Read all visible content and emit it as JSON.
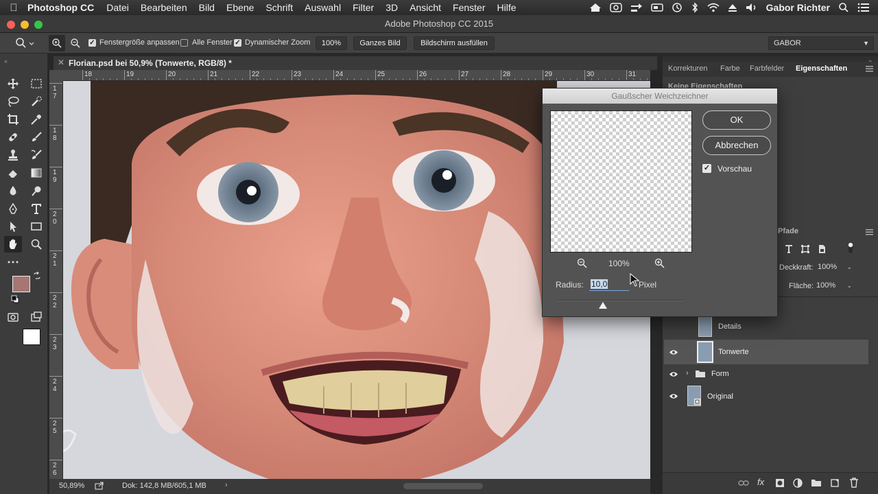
{
  "menubar": {
    "app": "Photoshop CC",
    "items": [
      "Datei",
      "Bearbeiten",
      "Bild",
      "Ebene",
      "Schrift",
      "Auswahl",
      "Filter",
      "3D",
      "Ansicht",
      "Fenster",
      "Hilfe"
    ],
    "user": "Gabor Richter"
  },
  "window": {
    "title": "Adobe Photoshop CC 2015"
  },
  "options": {
    "resize_windows": "Fenstergröße anpassen",
    "resize_windows_checked": true,
    "all_windows": "Alle Fenster",
    "all_windows_checked": false,
    "scrubby_zoom": "Dynamischer Zoom",
    "scrubby_zoom_checked": true,
    "btn_100": "100%",
    "btn_fit": "Ganzes Bild",
    "btn_fill": "Bildschirm ausfüllen",
    "workspace": "GABOR"
  },
  "document": {
    "tab_title": "Florian.psd bei 50,9% (Tonwerte, RGB/8) *",
    "ruler_top": [
      "18",
      "19",
      "20",
      "21",
      "22",
      "23",
      "24",
      "25",
      "26",
      "27",
      "28",
      "29",
      "30",
      "31"
    ],
    "ruler_left": [
      "1",
      "7",
      "1",
      "8",
      "1",
      "9",
      "2",
      "0",
      "2",
      "1",
      "2",
      "2",
      "2",
      "3",
      "2",
      "4",
      "2",
      "5",
      "2",
      "6"
    ]
  },
  "status": {
    "zoom": "50,89%",
    "doc": "Dok: 142,8 MB/605,1 MB"
  },
  "panels": {
    "tabs": [
      "Korrekturen",
      "Farbe",
      "Farbfelder",
      "Eigenschaften"
    ],
    "active_tab": "Eigenschaften",
    "no_properties": "Keine Eigenschaften",
    "paths_tab": "Pfade",
    "opacity_label": "Deckkraft:",
    "opacity": "100%",
    "fill_label": "Fläche:",
    "fill": "100%"
  },
  "layers": [
    {
      "name": "Details",
      "visible": false,
      "selected": false,
      "type": "pixel"
    },
    {
      "name": "Tonwerte",
      "visible": true,
      "selected": true,
      "type": "pixel"
    },
    {
      "name": "Form",
      "visible": true,
      "selected": false,
      "type": "group"
    },
    {
      "name": "Original",
      "visible": true,
      "selected": false,
      "type": "smart"
    }
  ],
  "dialog": {
    "title": "Gaußscher Weichzeichner",
    "ok": "OK",
    "cancel": "Abbrechen",
    "preview_label": "Vorschau",
    "preview_checked": true,
    "zoom": "100%",
    "radius_label": "Radius:",
    "radius_value": "10,0",
    "radius_unit": "Pixel",
    "slider_position": 0.36
  },
  "colors": {
    "foreground": "#a77673",
    "background": "#ffffff",
    "accent": "#4a90e2"
  }
}
